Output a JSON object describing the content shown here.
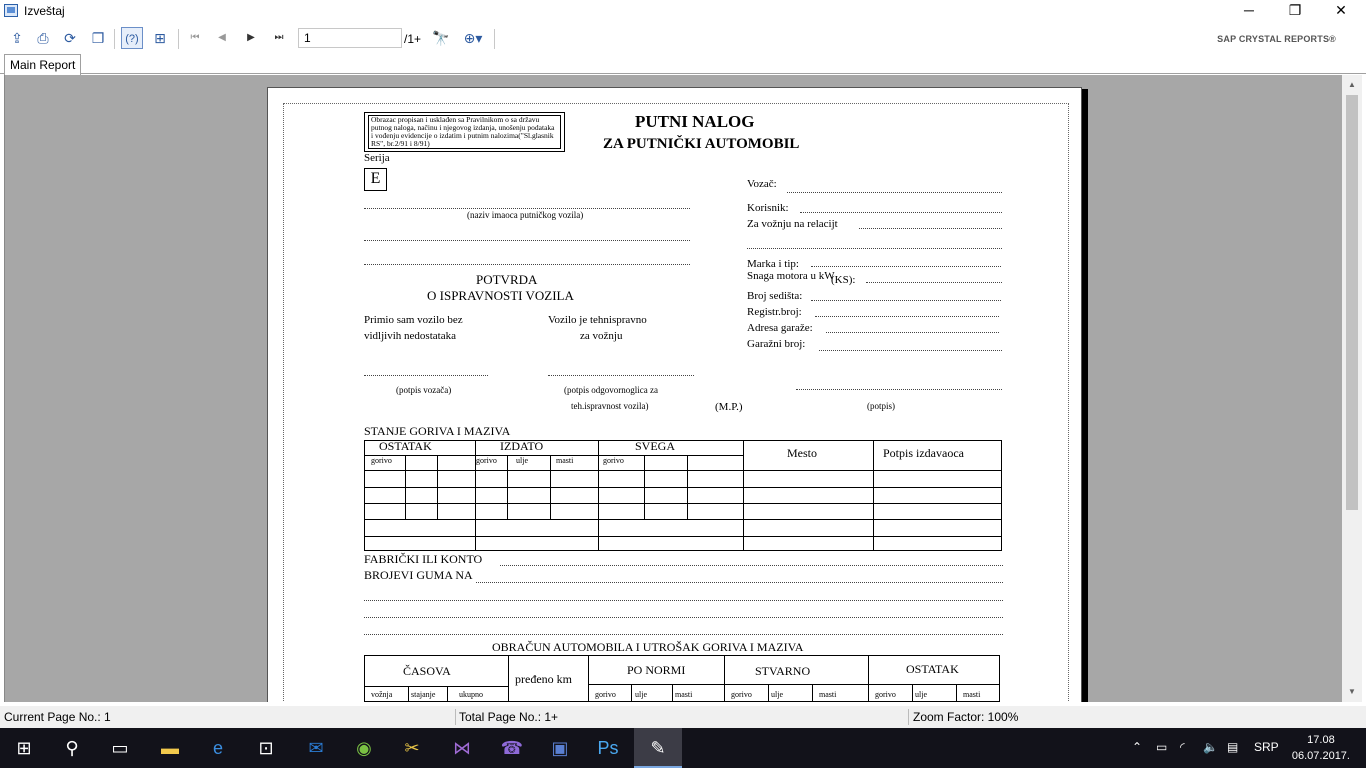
{
  "window": {
    "title": "Izveštaj",
    "minimize": "─",
    "restore": "❐",
    "close": "✕"
  },
  "toolbar": {
    "page_value": "1",
    "page_total": "/1+",
    "brand": "SAP CRYSTAL REPORTS®",
    "icons": [
      "export-icon",
      "print-icon",
      "refresh-icon",
      "copy-icon",
      "help-icon",
      "group-tree-icon",
      "first-page-icon",
      "prev-page-icon",
      "next-page-icon",
      "last-page-icon",
      "find-icon",
      "zoom-icon"
    ]
  },
  "tabs": [
    "Main Report"
  ],
  "report": {
    "legal": "Obrazac propisan i usklađen sa Pravilnikom o sa državu putnog naloga, načinu i njegovog izdanja, unošenju podataka i vođenju evidencije o izdatim i putnim nalozima(\"Sl.glasnik RS\", br.2/91 i 8/91)",
    "title1": "PUTNI NALOG",
    "title2": "ZA PUTNIČKI AUTOMOBIL",
    "serija_label": "Serija",
    "serija_value": "E",
    "naziv": "(naziv imaoca putničkog vozila)",
    "vozac": "Vozač:",
    "korisnik": "Korisnik:",
    "relacija": "Za vožnju na relacijt",
    "marka": "Marka i tip:",
    "snaga": "Snaga motora u kW",
    "ks": "(KS):",
    "sedista": "Broj sedišta:",
    "registr": "Registr.broj:",
    "adresa": "Adresa garaže:",
    "garazni": "Garažni broj:",
    "potvrda1": "POTVRDA",
    "potvrda2": "O ISPRAVNOSTI VOZILA",
    "primio1": "Primio sam vozilo bez",
    "primio2": "vidljivih nedostataka",
    "vozilo1": "Vozilo je tehnispravno",
    "vozilo2": "za vožnju",
    "potpis_vozaca": "(potpis vozača)",
    "potpis_odg1": "(potpis odgovornoglica za",
    "potpis_odg2": "teh.ispravnost vozila)",
    "mp": "(M.P.)",
    "potpis": "(potpis)",
    "stanje": "STANJE GORIVA I MAZIVA",
    "ostatak": "OSTATAK",
    "izdato": "IZDATO",
    "svega": "SVEGA",
    "mesto": "Mesto",
    "potpis_izd": "Potpis izdavaoca",
    "gorivo": "gorivo",
    "ulje": "ulje",
    "masti": "masti",
    "fabricki1": "FABRIČKI ILI KONTO",
    "fabricki2": "BROJEVI GUMA NA",
    "obracun": "OBRAČUN AUTOMOBILA I UTROŠAK GORIVA I MAZIVA",
    "casova": "ČASOVA",
    "predeno": "pređeno km",
    "po_normi": "PO NORMI",
    "stvarno": "STVARNO",
    "ostatak2": "OSTATAK",
    "voznja": "vožnja",
    "stajanje": "stajanje",
    "ukupno": "ukupno"
  },
  "status": {
    "current": "Current Page No.: 1",
    "total": "Total Page No.: 1+",
    "zoom": "Zoom Factor: 100%"
  },
  "taskbar": {
    "lang": "SRP",
    "time": "17.08",
    "date": "06.07.2017."
  }
}
